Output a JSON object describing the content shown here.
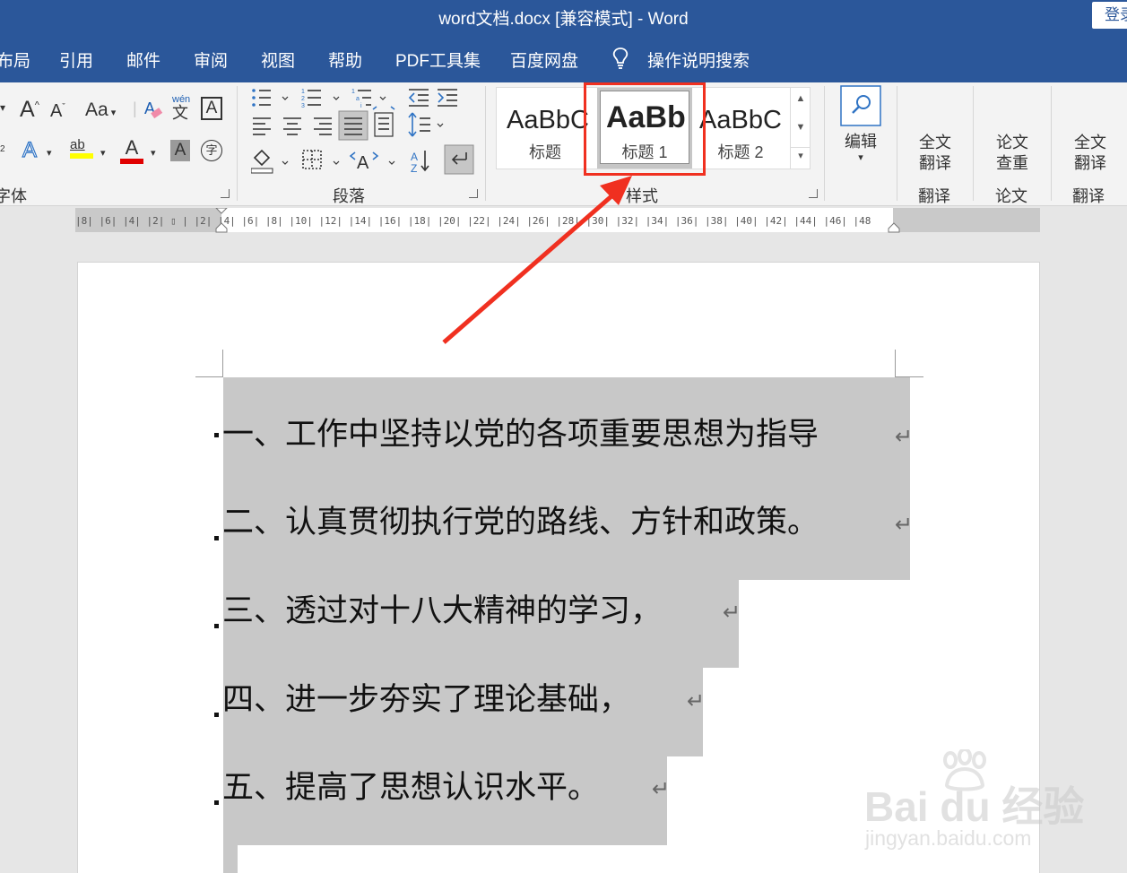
{
  "titlebar": {
    "title": "word文档.docx [兼容模式]  -  Word",
    "login": "登录"
  },
  "menu": {
    "tabs": [
      "布局",
      "引用",
      "邮件",
      "审阅",
      "视图",
      "帮助",
      "PDF工具集",
      "百度网盘"
    ],
    "tell_me": "操作说明搜索"
  },
  "ribbon": {
    "font_group": "字体",
    "paragraph_group": "段落",
    "styles_group": "样式",
    "styles": [
      {
        "sample": "AaBbC",
        "name": "标题"
      },
      {
        "sample": "AaBb",
        "name": "标题 1"
      },
      {
        "sample": "AaBbC",
        "name": "标题 2"
      }
    ],
    "edit_label": "编辑",
    "translate_full": {
      "line1": "全文",
      "line2": "翻译",
      "group": "翻译"
    },
    "paper_check": {
      "line1": "论文",
      "line2": "查重",
      "group": "论文"
    },
    "translate_full2": {
      "line1": "全文",
      "line2": "翻译",
      "group": "翻译"
    },
    "icons": {
      "font_grow": "A",
      "font_shrink": "A",
      "change_case": "Aa",
      "wen": "wén",
      "wen_char": "文",
      "char_border": "A",
      "text_effect": "A",
      "highlight": "ab",
      "font_color": "A",
      "char_shade": "A",
      "enclose_char": "字"
    },
    "colors": {
      "highlight": "#ffff00",
      "font_color": "#e00000"
    }
  },
  "ruler": {
    "numbers": "|8|  |6|  |4|  |2|  ▯  |  |2|  |4|  |6|  |8|  |10|  |12|  |14|  |16|  |18|  |20|  |22|  |24|  |26|  |28|  |30|  |32|  |34|  |36|  |38|  |40|  |42|  |44|  |46|  |48"
  },
  "document": {
    "lines": [
      "一、工作中坚持以党的各项重要思想为指导",
      "二、认真贯彻执行党的路线、方针和政策。",
      "三、透过对十八大精神的学习，",
      "四、进一步夯实了理论基础，",
      "五、提高了思想认识水平。"
    ],
    "para_mark": "↵"
  },
  "watermark": {
    "brand": "Bai du 经验",
    "url": "jingyan.baidu.com"
  },
  "annotation": {
    "color": "#f03020"
  }
}
